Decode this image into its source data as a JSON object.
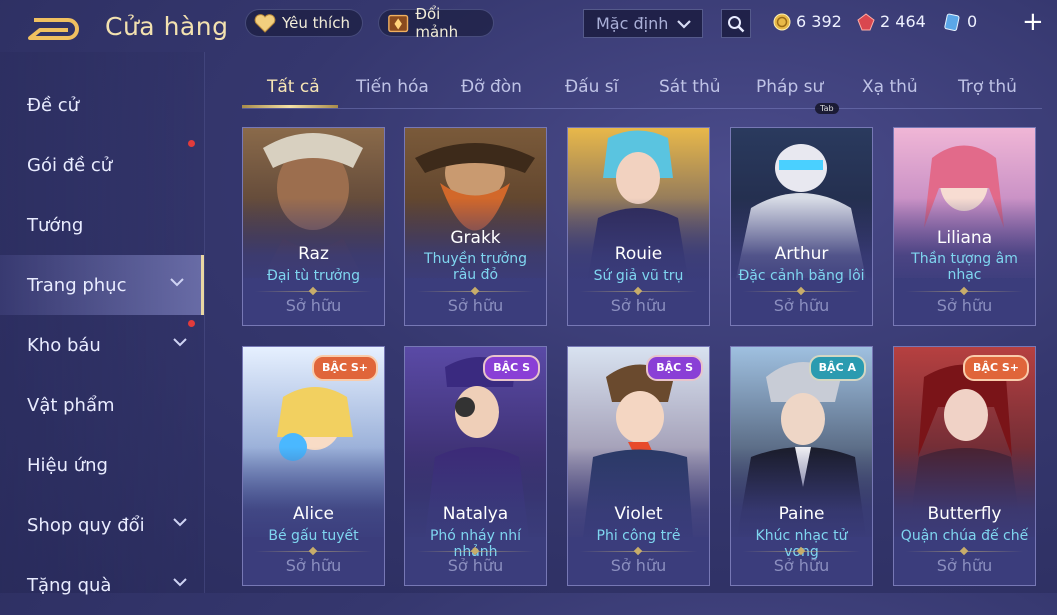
{
  "header": {
    "title": "Cửa hàng",
    "favorite_label": "Yêu thích",
    "shard_label": "Đổi mảnh",
    "sort_value": "Mặc định",
    "gold": "6 392",
    "ruby": "2 464",
    "voucher": "0"
  },
  "sidebar": {
    "items": [
      {
        "label": "Đề cử"
      },
      {
        "label": "Gói đề cử"
      },
      {
        "label": "Tướng"
      },
      {
        "label": "Trang phục"
      },
      {
        "label": "Kho báu"
      },
      {
        "label": "Vật phẩm"
      },
      {
        "label": "Hiệu ứng"
      },
      {
        "label": "Shop quy đổi"
      },
      {
        "label": "Tặng quà"
      }
    ]
  },
  "tabs": [
    {
      "label": "Tất cả"
    },
    {
      "label": "Tiến hóa"
    },
    {
      "label": "Đỡ đòn"
    },
    {
      "label": "Đấu sĩ"
    },
    {
      "label": "Sát thủ"
    },
    {
      "label": "Pháp sư"
    },
    {
      "label": "Xạ thủ"
    },
    {
      "label": "Trợ thủ"
    }
  ],
  "tab_hint": "Tab",
  "cards": [
    {
      "hero": "Raz",
      "skin": "Đại tù trưởng",
      "status": "Sở hữu"
    },
    {
      "hero": "Grakk",
      "skin": "Thuyền trưởng râu đỏ",
      "status": "Sở hữu"
    },
    {
      "hero": "Rouie",
      "skin": "Sứ giả vũ trụ",
      "status": "Sở hữu"
    },
    {
      "hero": "Arthur",
      "skin": "Đặc cảnh băng lôi",
      "status": "Sở hữu"
    },
    {
      "hero": "Liliana",
      "skin": "Thần tượng âm nhạc",
      "status": "Sở hữu"
    },
    {
      "hero": "Alice",
      "skin": "Bé gấu tuyết",
      "status": "Sở hữu",
      "badge": "BẬC S+"
    },
    {
      "hero": "Natalya",
      "skin": "Phó nháy nhí nhảnh",
      "status": "Sở hữu",
      "badge": "BẬC S"
    },
    {
      "hero": "Violet",
      "skin": "Phi công trẻ",
      "status": "Sở hữu",
      "badge": "BẬC S"
    },
    {
      "hero": "Paine",
      "skin": "Khúc nhạc tử vong",
      "status": "Sở hữu",
      "badge": "BẬC A"
    },
    {
      "hero": "Butterfly",
      "skin": "Quận chúa đế chế",
      "status": "Sở hữu",
      "badge": "BẬC S+"
    }
  ],
  "colors": {
    "accent_gold": "#f3e2b0",
    "skin_name": "#7fd6f0",
    "badge_s_plus": "#e0653a",
    "badge_s": "#8a3fd6",
    "badge_a": "#2a9bb0"
  }
}
